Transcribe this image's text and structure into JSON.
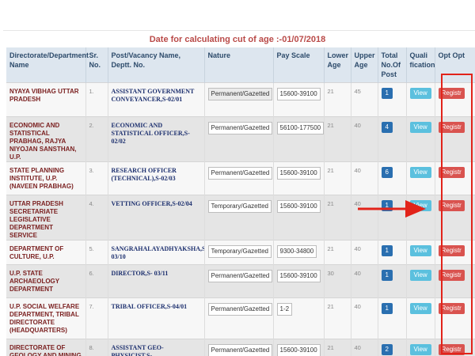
{
  "caption": "Date for calculating cut of age :-01/07/2018",
  "columns": {
    "dept": "Directorate/Department Name",
    "sno": "Sr. No.",
    "post": "Post/Vacancy Name, Deptt. No.",
    "nature": "Nature",
    "scale": "Pay Scale",
    "lower": "Lower Age",
    "upper": "Upper Age",
    "total": "Total No.Of Post",
    "qual": "Quali fication",
    "opt": "Opt Opt"
  },
  "rows": [
    {
      "dept": "NYAYA VIBHAG UTTAR PRADESH",
      "sno": "1.",
      "post": "ASSISTANT GOVERNMENT CONVEYANCER,S-02/01",
      "nature": "Permanent/Gazetted",
      "scale": "15600-39100",
      "lower": "21",
      "upper": "45",
      "total": "1",
      "qual": "View",
      "opt": "Registr"
    },
    {
      "dept": "ECONOMIC AND STATISTICAL PRABHAG, RAJYA NIYOJAN SANSTHAN, U.P.",
      "sno": "2.",
      "post": "ECONOMIC AND STATISTICAL OFFICER,S-02/02",
      "nature": "Permanent/Gazetted",
      "scale": "56100-177500",
      "lower": "21",
      "upper": "40",
      "total": "4",
      "qual": "View",
      "opt": "Registr"
    },
    {
      "dept": "STATE PLANNING INSTITUTE, U.P. (NAVEEN PRABHAG)",
      "sno": "3.",
      "post": "RESEARCH OFFICER (TECHNICAL),S-02/03",
      "nature": "Permanent/Gazetted",
      "scale": "15600-39100",
      "lower": "21",
      "upper": "40",
      "total": "6",
      "qual": "View",
      "opt": "Registr"
    },
    {
      "dept": "UTTAR PRADESH SECRETARIATE LEGISLATIVE DEPARTMENT SERVICE",
      "sno": "4.",
      "post": "VETTING OFFICER,S-02/04",
      "nature": "Temporary/Gazetted",
      "scale": "15600-39100",
      "lower": "21",
      "upper": "40",
      "total": "1",
      "qual": "View",
      "opt": "Registr"
    },
    {
      "dept": "DEPARTMENT OF CULTURE, U.P.",
      "sno": "5.",
      "post": "SANGRAHALAYADHYAKSHA,S-03/10",
      "nature": "Temporary/Gazetted",
      "scale": "9300-34800",
      "lower": "21",
      "upper": "40",
      "total": "1",
      "qual": "View",
      "opt": "Registr"
    },
    {
      "dept": "U.P. STATE ARCHAEOLOGY DEPARTMENT",
      "sno": "6.",
      "post": "DIRECTOR,S- 03/11",
      "nature": "Permanent/Gazetted",
      "scale": "15600-39100",
      "lower": "30",
      "upper": "40",
      "total": "1",
      "qual": "View",
      "opt": "Registr"
    },
    {
      "dept": "U.P. SOCIAL WELFARE DEPARTMENT, TRIBAL DIRECTORATE (HEADQUARTERS)",
      "sno": "7.",
      "post": "TRIBAL OFFICER,S-04/01",
      "nature": "Permanent/Gazetted",
      "scale": "1-2",
      "lower": "21",
      "upper": "40",
      "total": "1",
      "qual": "View",
      "opt": "Registr"
    },
    {
      "dept": "DIRECTORATE OF GEOLOGY AND MINING",
      "sno": "8.",
      "post": "ASSISTANT GEO-PHYSICIST,S-",
      "nature": "Permanent/Gazetted",
      "scale": "15600-39100",
      "lower": "21",
      "upper": "40",
      "total": "2",
      "qual": "View",
      "opt": "Registr"
    }
  ],
  "colors": {
    "highlight": "#e2231a",
    "header_bg": "#dde6ef",
    "caption": "#b94a48"
  }
}
